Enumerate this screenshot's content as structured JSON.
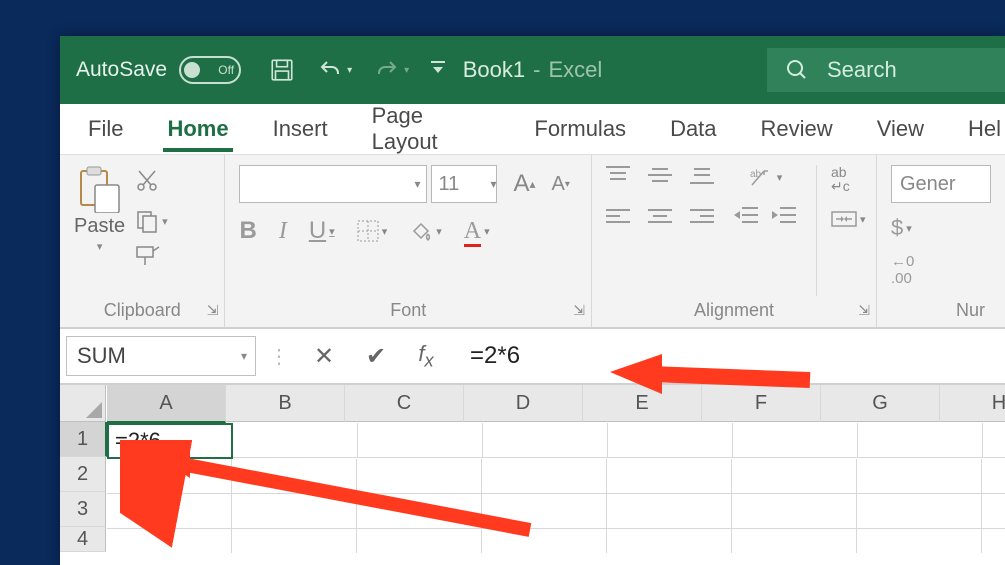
{
  "title_bar": {
    "autosave_label": "AutoSave",
    "autosave_state": "Off",
    "doc_name": "Book1",
    "app_name": "Excel",
    "search_placeholder": "Search"
  },
  "tabs": {
    "file": "File",
    "home": "Home",
    "insert": "Insert",
    "page_layout": "Page Layout",
    "formulas": "Formulas",
    "data": "Data",
    "review": "Review",
    "view": "View",
    "help": "Hel"
  },
  "ribbon": {
    "clipboard": {
      "paste": "Paste",
      "label": "Clipboard"
    },
    "font": {
      "size": "11",
      "bold": "B",
      "italic": "I",
      "underline": "U",
      "label": "Font"
    },
    "alignment": {
      "label": "Alignment"
    },
    "number": {
      "format": "Gener",
      "currency": "$",
      "label": "Nur"
    }
  },
  "formula_bar": {
    "name_box": "SUM",
    "formula": "=2*6"
  },
  "grid": {
    "columns": [
      "A",
      "B",
      "C",
      "D",
      "E",
      "F",
      "G",
      "H"
    ],
    "rows": [
      "1",
      "2",
      "3",
      "4"
    ],
    "active_cell_value": "=2*6"
  }
}
